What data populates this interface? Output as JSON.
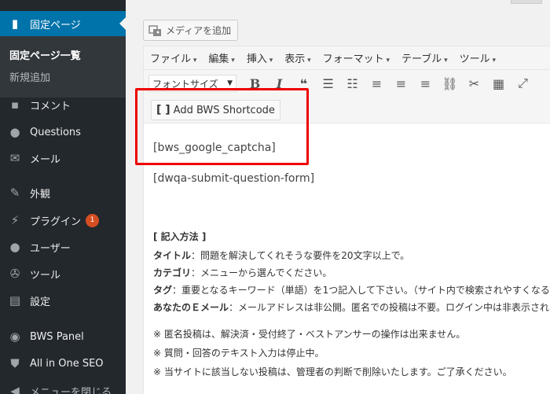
{
  "sidebar": {
    "active": {
      "label": "固定ページ",
      "icon": "pages-icon"
    },
    "submenu": {
      "current": "固定ページ一覧",
      "add_new": "新規追加"
    },
    "items": [
      {
        "label": "コメント",
        "icon": "comment-icon"
      },
      {
        "label": "Questions",
        "icon": "question-icon"
      },
      {
        "label": "メール",
        "icon": "mail-icon"
      },
      {
        "label": "外観",
        "icon": "appearance-icon"
      },
      {
        "label": "プラグイン",
        "icon": "plugin-icon",
        "badge": "1"
      },
      {
        "label": "ユーザー",
        "icon": "user-icon"
      },
      {
        "label": "ツール",
        "icon": "tools-icon"
      },
      {
        "label": "設定",
        "icon": "settings-icon"
      },
      {
        "label": "BWS Panel",
        "icon": "bws-icon"
      },
      {
        "label": "All in One SEO",
        "icon": "seo-shield-icon"
      },
      {
        "label": "メニューを閉じる",
        "icon": "collapse-icon"
      }
    ]
  },
  "editor": {
    "media_button": "メディアを追加",
    "menubar": [
      "ファイル",
      "編集",
      "挿入",
      "表示",
      "フォーマット",
      "テーブル",
      "ツール"
    ],
    "font_size_select": "フォントサイズ",
    "bws_button": "Add BWS Shortcode",
    "content": {
      "shortcode1": "[bws_google_captcha]",
      "shortcode2": "[dwqa-submit-question-form]",
      "guide_title": "[ 記入方法 ]",
      "lines": [
        {
          "label": "タイトル",
          "text": "：問題を解決してくれそうな要件を20文字以上で。"
        },
        {
          "label": "カテゴリ",
          "text": "：メニューから選んでください。"
        },
        {
          "label": "タグ",
          "text": "：重要となるキーワード（単語）を1つ記入して下さい。（サイト内で検索されやすくなる"
        },
        {
          "label": "あなたのＥメール",
          "text": "：メールアドレスは非公開。匿名での投稿は不要。ログイン中は非表示され"
        }
      ],
      "notes": [
        "※ 匿名投稿は、解決済・受付終了・ベストアンサーの操作は出来ません。",
        "※ 質問・回答のテキスト入力は停止中。",
        "※ 当サイトに該当しない投稿は、管理者の判断で削除いたします。ご了承ください。"
      ]
    }
  },
  "colors": {
    "sidebar_bg": "#23282d",
    "active_bg": "#0073aa",
    "highlight": "#ee0000",
    "badge": "#d54e21"
  }
}
